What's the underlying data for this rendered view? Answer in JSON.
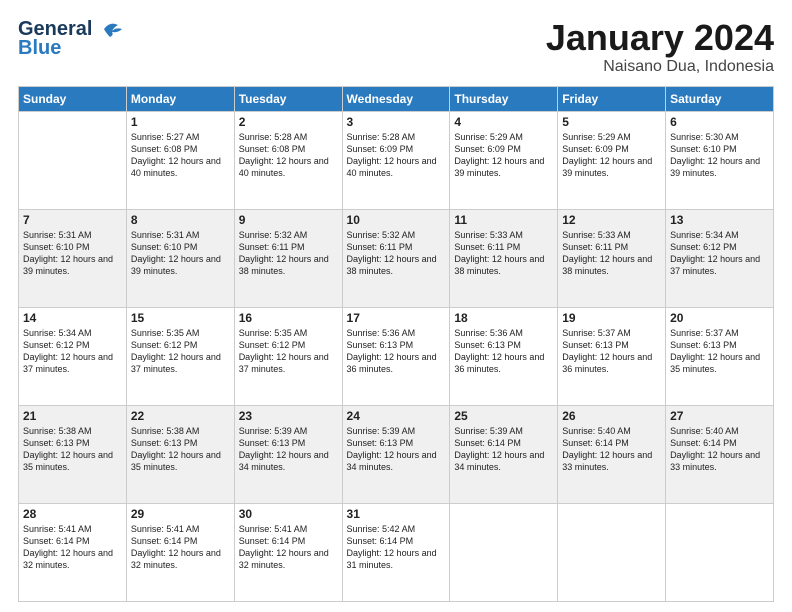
{
  "header": {
    "logo_line1": "General",
    "logo_line2": "Blue",
    "title": "January 2024",
    "subtitle": "Naisano Dua, Indonesia"
  },
  "weekdays": [
    "Sunday",
    "Monday",
    "Tuesday",
    "Wednesday",
    "Thursday",
    "Friday",
    "Saturday"
  ],
  "weeks": [
    [
      {
        "day": "",
        "sunrise": "",
        "sunset": "",
        "daylight": ""
      },
      {
        "day": "1",
        "sunrise": "Sunrise: 5:27 AM",
        "sunset": "Sunset: 6:08 PM",
        "daylight": "Daylight: 12 hours and 40 minutes."
      },
      {
        "day": "2",
        "sunrise": "Sunrise: 5:28 AM",
        "sunset": "Sunset: 6:08 PM",
        "daylight": "Daylight: 12 hours and 40 minutes."
      },
      {
        "day": "3",
        "sunrise": "Sunrise: 5:28 AM",
        "sunset": "Sunset: 6:09 PM",
        "daylight": "Daylight: 12 hours and 40 minutes."
      },
      {
        "day": "4",
        "sunrise": "Sunrise: 5:29 AM",
        "sunset": "Sunset: 6:09 PM",
        "daylight": "Daylight: 12 hours and 39 minutes."
      },
      {
        "day": "5",
        "sunrise": "Sunrise: 5:29 AM",
        "sunset": "Sunset: 6:09 PM",
        "daylight": "Daylight: 12 hours and 39 minutes."
      },
      {
        "day": "6",
        "sunrise": "Sunrise: 5:30 AM",
        "sunset": "Sunset: 6:10 PM",
        "daylight": "Daylight: 12 hours and 39 minutes."
      }
    ],
    [
      {
        "day": "7",
        "sunrise": "Sunrise: 5:31 AM",
        "sunset": "Sunset: 6:10 PM",
        "daylight": "Daylight: 12 hours and 39 minutes."
      },
      {
        "day": "8",
        "sunrise": "Sunrise: 5:31 AM",
        "sunset": "Sunset: 6:10 PM",
        "daylight": "Daylight: 12 hours and 39 minutes."
      },
      {
        "day": "9",
        "sunrise": "Sunrise: 5:32 AM",
        "sunset": "Sunset: 6:11 PM",
        "daylight": "Daylight: 12 hours and 38 minutes."
      },
      {
        "day": "10",
        "sunrise": "Sunrise: 5:32 AM",
        "sunset": "Sunset: 6:11 PM",
        "daylight": "Daylight: 12 hours and 38 minutes."
      },
      {
        "day": "11",
        "sunrise": "Sunrise: 5:33 AM",
        "sunset": "Sunset: 6:11 PM",
        "daylight": "Daylight: 12 hours and 38 minutes."
      },
      {
        "day": "12",
        "sunrise": "Sunrise: 5:33 AM",
        "sunset": "Sunset: 6:11 PM",
        "daylight": "Daylight: 12 hours and 38 minutes."
      },
      {
        "day": "13",
        "sunrise": "Sunrise: 5:34 AM",
        "sunset": "Sunset: 6:12 PM",
        "daylight": "Daylight: 12 hours and 37 minutes."
      }
    ],
    [
      {
        "day": "14",
        "sunrise": "Sunrise: 5:34 AM",
        "sunset": "Sunset: 6:12 PM",
        "daylight": "Daylight: 12 hours and 37 minutes."
      },
      {
        "day": "15",
        "sunrise": "Sunrise: 5:35 AM",
        "sunset": "Sunset: 6:12 PM",
        "daylight": "Daylight: 12 hours and 37 minutes."
      },
      {
        "day": "16",
        "sunrise": "Sunrise: 5:35 AM",
        "sunset": "Sunset: 6:12 PM",
        "daylight": "Daylight: 12 hours and 37 minutes."
      },
      {
        "day": "17",
        "sunrise": "Sunrise: 5:36 AM",
        "sunset": "Sunset: 6:13 PM",
        "daylight": "Daylight: 12 hours and 36 minutes."
      },
      {
        "day": "18",
        "sunrise": "Sunrise: 5:36 AM",
        "sunset": "Sunset: 6:13 PM",
        "daylight": "Daylight: 12 hours and 36 minutes."
      },
      {
        "day": "19",
        "sunrise": "Sunrise: 5:37 AM",
        "sunset": "Sunset: 6:13 PM",
        "daylight": "Daylight: 12 hours and 36 minutes."
      },
      {
        "day": "20",
        "sunrise": "Sunrise: 5:37 AM",
        "sunset": "Sunset: 6:13 PM",
        "daylight": "Daylight: 12 hours and 35 minutes."
      }
    ],
    [
      {
        "day": "21",
        "sunrise": "Sunrise: 5:38 AM",
        "sunset": "Sunset: 6:13 PM",
        "daylight": "Daylight: 12 hours and 35 minutes."
      },
      {
        "day": "22",
        "sunrise": "Sunrise: 5:38 AM",
        "sunset": "Sunset: 6:13 PM",
        "daylight": "Daylight: 12 hours and 35 minutes."
      },
      {
        "day": "23",
        "sunrise": "Sunrise: 5:39 AM",
        "sunset": "Sunset: 6:13 PM",
        "daylight": "Daylight: 12 hours and 34 minutes."
      },
      {
        "day": "24",
        "sunrise": "Sunrise: 5:39 AM",
        "sunset": "Sunset: 6:13 PM",
        "daylight": "Daylight: 12 hours and 34 minutes."
      },
      {
        "day": "25",
        "sunrise": "Sunrise: 5:39 AM",
        "sunset": "Sunset: 6:14 PM",
        "daylight": "Daylight: 12 hours and 34 minutes."
      },
      {
        "day": "26",
        "sunrise": "Sunrise: 5:40 AM",
        "sunset": "Sunset: 6:14 PM",
        "daylight": "Daylight: 12 hours and 33 minutes."
      },
      {
        "day": "27",
        "sunrise": "Sunrise: 5:40 AM",
        "sunset": "Sunset: 6:14 PM",
        "daylight": "Daylight: 12 hours and 33 minutes."
      }
    ],
    [
      {
        "day": "28",
        "sunrise": "Sunrise: 5:41 AM",
        "sunset": "Sunset: 6:14 PM",
        "daylight": "Daylight: 12 hours and 32 minutes."
      },
      {
        "day": "29",
        "sunrise": "Sunrise: 5:41 AM",
        "sunset": "Sunset: 6:14 PM",
        "daylight": "Daylight: 12 hours and 32 minutes."
      },
      {
        "day": "30",
        "sunrise": "Sunrise: 5:41 AM",
        "sunset": "Sunset: 6:14 PM",
        "daylight": "Daylight: 12 hours and 32 minutes."
      },
      {
        "day": "31",
        "sunrise": "Sunrise: 5:42 AM",
        "sunset": "Sunset: 6:14 PM",
        "daylight": "Daylight: 12 hours and 31 minutes."
      },
      {
        "day": "",
        "sunrise": "",
        "sunset": "",
        "daylight": ""
      },
      {
        "day": "",
        "sunrise": "",
        "sunset": "",
        "daylight": ""
      },
      {
        "day": "",
        "sunrise": "",
        "sunset": "",
        "daylight": ""
      }
    ]
  ]
}
